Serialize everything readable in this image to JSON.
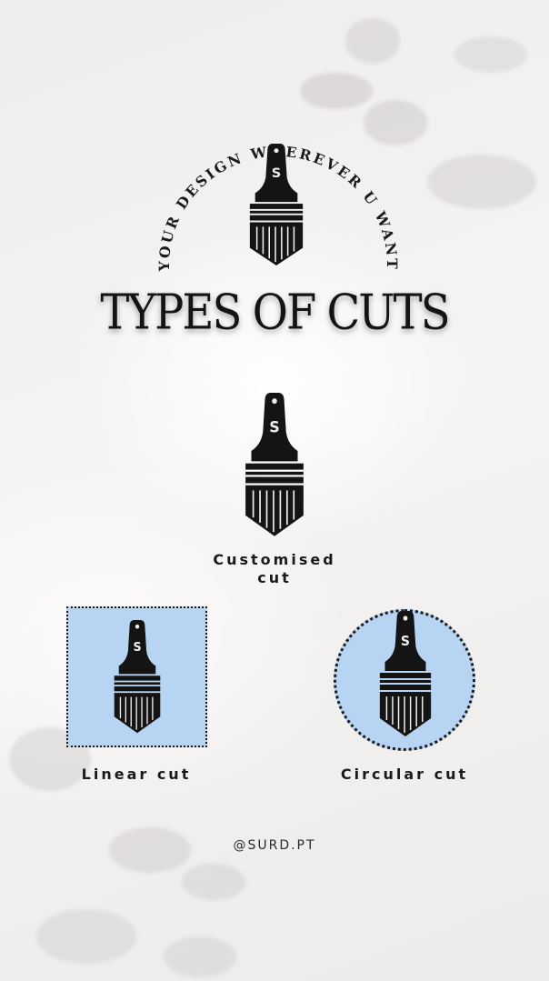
{
  "arc_text": "YOUR DESIGN WHEREVER U WANT",
  "title": "TYPES OF CUTS",
  "logo_letter": "S",
  "cuts": {
    "customised": {
      "line1": "Customised",
      "line2": "cut"
    },
    "linear": {
      "label": "Linear cut"
    },
    "circular": {
      "label": "Circular cut"
    }
  },
  "handle": "@SURD.PT",
  "colors": {
    "background": "#f0eeed",
    "ink": "#141414",
    "cut_fill": "#b7d5f3"
  }
}
